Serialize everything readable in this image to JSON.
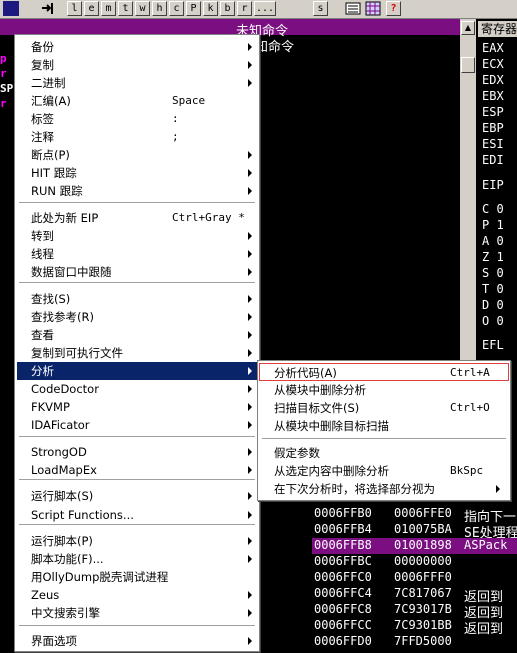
{
  "toolbar": {
    "buttons": [
      "l",
      "e",
      "m",
      "t",
      "w",
      "h",
      "c",
      "P",
      "k",
      "b",
      "r",
      "...",
      "s"
    ],
    "help": "?"
  },
  "title_bar": {
    "text": "未知命令",
    "text2": "知命令"
  },
  "registers": {
    "header": "寄存器",
    "names": [
      "EAX",
      "ECX",
      "EDX",
      "EBX",
      "ESP",
      "EBP",
      "ESI",
      "EDI",
      "EIP",
      "C 0",
      "P 1",
      "A 0",
      "Z 1",
      "S 0",
      "T 0",
      "D 0",
      "O 0",
      "EFL"
    ]
  },
  "left_fragments": [
    "p",
    "r",
    "SP",
    "r",
    "",
    "",
    "",
    "",
    "",
    "",
    "",
    "",
    "",
    "",
    "",
    "",
    "",
    "",
    "",
    "",
    "",
    "",
    "",
    "",
    "",
    "",
    "",
    "",
    "",
    "",
    ""
  ],
  "stack": [
    {
      "addr": "0006FFB0",
      "val": "0006FFE0",
      "cmt": "指向下一"
    },
    {
      "addr": "0006FFB4",
      "val": "010075BA",
      "cmt": "SE处理程"
    },
    {
      "addr": "0006FFB8",
      "val": "01001898",
      "cmt": "ASPack"
    },
    {
      "addr": "0006FFBC",
      "val": "00000000",
      "cmt": ""
    },
    {
      "addr": "0006FFC0",
      "val": "0006FFF0",
      "cmt": ""
    },
    {
      "addr": "0006FFC4",
      "val": "7C817067",
      "cmt": "返回到"
    },
    {
      "addr": "0006FFC8",
      "val": "7C93017B",
      "cmt": "返回到"
    },
    {
      "addr": "0006FFCC",
      "val": "7C9301BB",
      "cmt": "返回到"
    },
    {
      "addr": "0006FFD0",
      "val": "7FFD5000",
      "cmt": ""
    }
  ],
  "context_menu": {
    "items": [
      {
        "label": "备份",
        "shortcut": "",
        "submenu": true
      },
      {
        "label": "复制",
        "shortcut": "",
        "submenu": true
      },
      {
        "label": "二进制",
        "shortcut": "",
        "submenu": true
      },
      {
        "label": "汇编(A)",
        "shortcut": "Space",
        "submenu": false
      },
      {
        "label": "标签",
        "shortcut": ":",
        "submenu": false
      },
      {
        "label": "注释",
        "shortcut": ";",
        "submenu": false
      },
      {
        "label": "断点(P)",
        "shortcut": "",
        "submenu": true
      },
      {
        "label": "HIT 跟踪",
        "shortcut": "",
        "submenu": true
      },
      {
        "label": "RUN 跟踪",
        "shortcut": "",
        "submenu": true
      },
      {
        "label": "此处为新 EIP",
        "shortcut": "Ctrl+Gray *",
        "submenu": false
      },
      {
        "label": "转到",
        "shortcut": "",
        "submenu": true
      },
      {
        "label": "线程",
        "shortcut": "",
        "submenu": true
      },
      {
        "label": "数据窗口中跟随",
        "shortcut": "",
        "submenu": true
      },
      {
        "label": "查找(S)",
        "shortcut": "",
        "submenu": true
      },
      {
        "label": "查找参考(R)",
        "shortcut": "",
        "submenu": true
      },
      {
        "label": "查看",
        "shortcut": "",
        "submenu": true
      },
      {
        "label": "复制到可执行文件",
        "shortcut": "",
        "submenu": true
      },
      {
        "label": "分析",
        "shortcut": "",
        "submenu": true
      },
      {
        "label": "CodeDoctor",
        "shortcut": "",
        "submenu": true
      },
      {
        "label": "FKVMP",
        "shortcut": "",
        "submenu": true
      },
      {
        "label": "IDAFicator",
        "shortcut": "",
        "submenu": true
      },
      {
        "label": "StrongOD",
        "shortcut": "",
        "submenu": true
      },
      {
        "label": "LoadMapEx",
        "shortcut": "",
        "submenu": true
      },
      {
        "label": "运行脚本(S)",
        "shortcut": "",
        "submenu": true
      },
      {
        "label": "Script Functions...",
        "shortcut": "",
        "submenu": true
      },
      {
        "label": "运行脚本(P)",
        "shortcut": "",
        "submenu": true
      },
      {
        "label": "脚本功能(F)...",
        "shortcut": "",
        "submenu": true
      },
      {
        "label": "用OllyDump脱壳调试进程",
        "shortcut": "",
        "submenu": false
      },
      {
        "label": "Zeus",
        "shortcut": "",
        "submenu": true
      },
      {
        "label": "中文搜索引擎",
        "shortcut": "",
        "submenu": true
      },
      {
        "label": "界面选项",
        "shortcut": "",
        "submenu": true
      }
    ]
  },
  "analysis_submenu": {
    "items": [
      {
        "label": "分析代码(A)",
        "shortcut": "Ctrl+A",
        "submenu": false
      },
      {
        "label": "从模块中删除分析",
        "shortcut": "",
        "submenu": false
      },
      {
        "label": "扫描目标文件(S)",
        "shortcut": "Ctrl+O",
        "submenu": false
      },
      {
        "label": "从模块中删除目标扫描",
        "shortcut": "",
        "submenu": false
      },
      {
        "label": "假定参数",
        "shortcut": "",
        "submenu": false
      },
      {
        "label": "从选定内容中删除分析",
        "shortcut": "BkSpc",
        "submenu": false
      },
      {
        "label": "在下次分析时，将选择部分视为",
        "shortcut": "",
        "submenu": true
      }
    ]
  },
  "colors": {
    "title_bar": "#7b0f82",
    "menu_highlight": "#0a246a",
    "submenu_highlight_border": "#e04040",
    "stack_selected": "#7b0f82"
  }
}
